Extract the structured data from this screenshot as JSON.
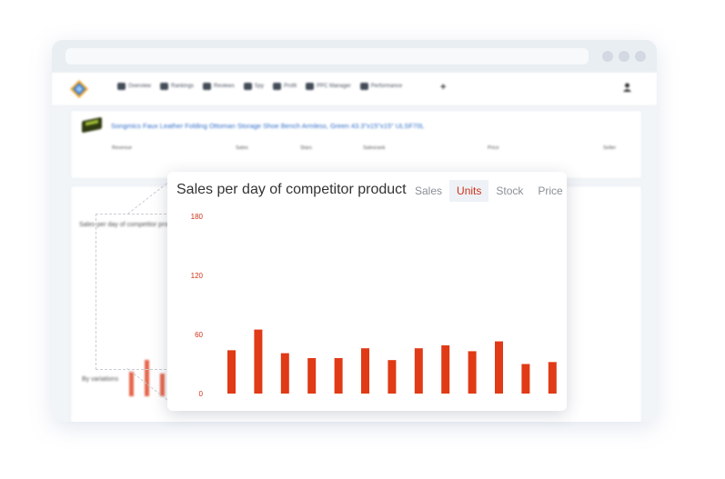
{
  "nav": {
    "items": [
      {
        "label": "Overview",
        "icon": "home-icon"
      },
      {
        "label": "Rankings",
        "icon": "chart-icon"
      },
      {
        "label": "Reviews",
        "icon": "thumbs-up-icon"
      },
      {
        "label": "Spy",
        "icon": "binoculars-icon"
      },
      {
        "label": "Profit",
        "icon": "money-icon"
      },
      {
        "label": "PPC Manager",
        "icon": "megaphone-icon"
      },
      {
        "label": "Performance",
        "icon": "rocket-icon"
      }
    ]
  },
  "product": {
    "title": "Songmics Faux Leather Folding Ottoman Storage Shoe Bench Armless, Green 43.3\"x15\"x15\" ULSF70L",
    "stats": [
      {
        "label": "Revenue"
      },
      {
        "label": "Sales"
      },
      {
        "label": "Stars"
      },
      {
        "label": "Salesrank"
      },
      {
        "label": "Price"
      },
      {
        "label": "Seller"
      }
    ]
  },
  "background": {
    "chart_title": "Sales per day of competitor product",
    "variations_label": "By variations"
  },
  "popup": {
    "title": "Sales per day of competitor product",
    "tabs": [
      "Sales",
      "Units",
      "Stock",
      "Price"
    ],
    "active_tab": "Units"
  },
  "chart_data": {
    "type": "bar",
    "title": "Sales per day of competitor product",
    "y_ticks": [
      0,
      60,
      120,
      180
    ],
    "ylim": [
      0,
      180
    ],
    "values": [
      44,
      65,
      41,
      36,
      36,
      46,
      34,
      46,
      49,
      43,
      53,
      30,
      32
    ],
    "bar_color": "#e03a16"
  },
  "colors": {
    "accent": "#cc3318",
    "link": "#2d6bc9"
  }
}
